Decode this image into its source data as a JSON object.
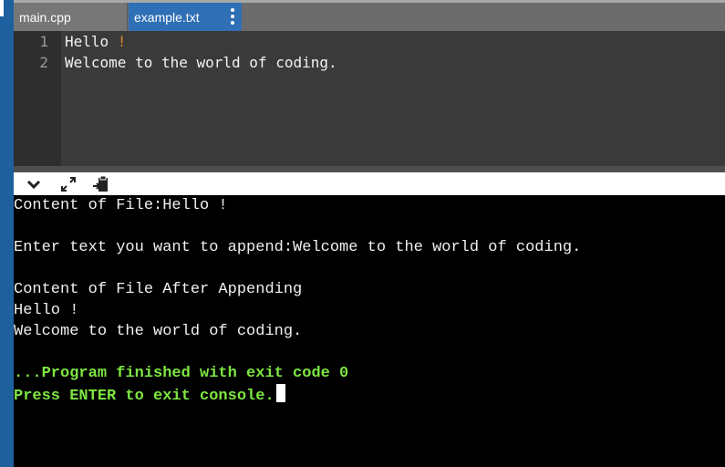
{
  "tabs": [
    {
      "label": "main.cpp",
      "active": false
    },
    {
      "label": "example.txt",
      "active": true
    }
  ],
  "editor": {
    "lines": [
      {
        "num": "1",
        "text": "Hello ",
        "bang": "!"
      },
      {
        "num": "2",
        "text": "Welcome to the world of coding.",
        "bang": ""
      }
    ]
  },
  "toolbar": {
    "icons": [
      "chevron-down-icon",
      "expand-icon",
      "paste-icon"
    ]
  },
  "console": {
    "lines": [
      "Content of File:Hello !",
      "",
      "Enter text you want to append:Welcome to the world of coding.",
      "",
      "Content of File After Appending",
      "Hello !",
      "Welcome to the world of coding.",
      "",
      "...Program finished with exit code 0",
      "Press ENTER to exit console."
    ]
  },
  "colors": {
    "accent": "#2f6fb5",
    "console_green": "#7de642",
    "bang_orange": "#e08a2c"
  }
}
